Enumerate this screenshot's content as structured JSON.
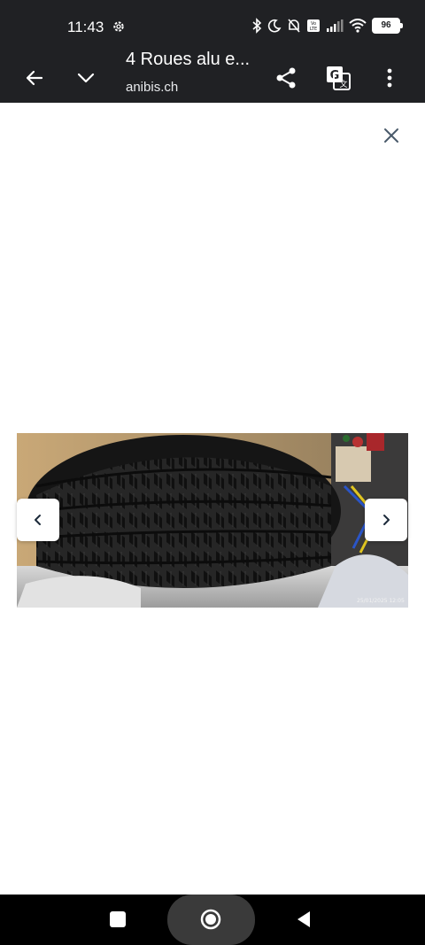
{
  "status_bar": {
    "time": "11:43",
    "battery": "96",
    "icons": [
      "settings-icon",
      "bluetooth-icon",
      "moon-icon",
      "bell-off-icon",
      "volte-icon",
      "signal-icon",
      "wifi-icon",
      "battery-icon"
    ]
  },
  "toolbar": {
    "title": "4 Roues alu e...",
    "url": "anibis.ch",
    "icons": [
      "back-arrow-icon",
      "chevron-down-icon",
      "share-icon",
      "translate-icon",
      "more-vert-icon"
    ]
  },
  "viewer": {
    "close_icon": "close-icon",
    "prev_icon": "chevron-left-icon",
    "next_icon": "chevron-right-icon",
    "photo_timestamp": "25/01/2025 12:05"
  },
  "nav_bar": {
    "icons": [
      "square-icon",
      "circle-home-icon",
      "triangle-back-icon"
    ]
  }
}
